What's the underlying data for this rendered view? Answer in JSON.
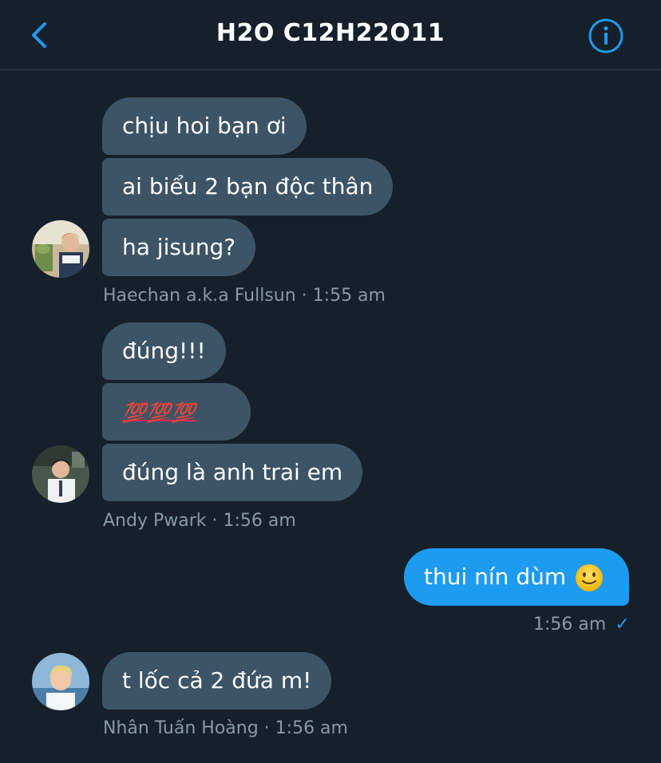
{
  "header": {
    "title": "H2O C12H22O11",
    "back_icon": "chevron-left-icon",
    "info_icon": "info-circle-icon",
    "accent_color": "#1d9bf0"
  },
  "messages": [
    {
      "sender": "Haechan a.k.a Fullsun",
      "time": "1:55 am",
      "bubbles": [
        "chịu hoi bạn ơi",
        "ai biểu 2 bạn độc thân",
        "ha jisung?"
      ]
    },
    {
      "sender": "Andy Pwark",
      "time": "1:56 am",
      "bubbles": [
        "đúng!!!",
        "💯💯💯",
        "đúng là anh trai em"
      ]
    },
    {
      "sender": "me",
      "time": "1:56 am",
      "check": "✓",
      "bubbles": [
        "thui nín dùm"
      ],
      "emoji": "slightly-smiling-face-icon"
    },
    {
      "sender": "Nhân Tuấn Hoàng",
      "time": "1:56 am",
      "bubbles": [
        "t lốc cả 2 đứa m!"
      ]
    }
  ],
  "separator": " · ",
  "colors": {
    "background": "#15202b",
    "incoming_bubble": "#3d5466",
    "outgoing_bubble": "#1d9bf0",
    "meta_text": "#8899a6"
  }
}
